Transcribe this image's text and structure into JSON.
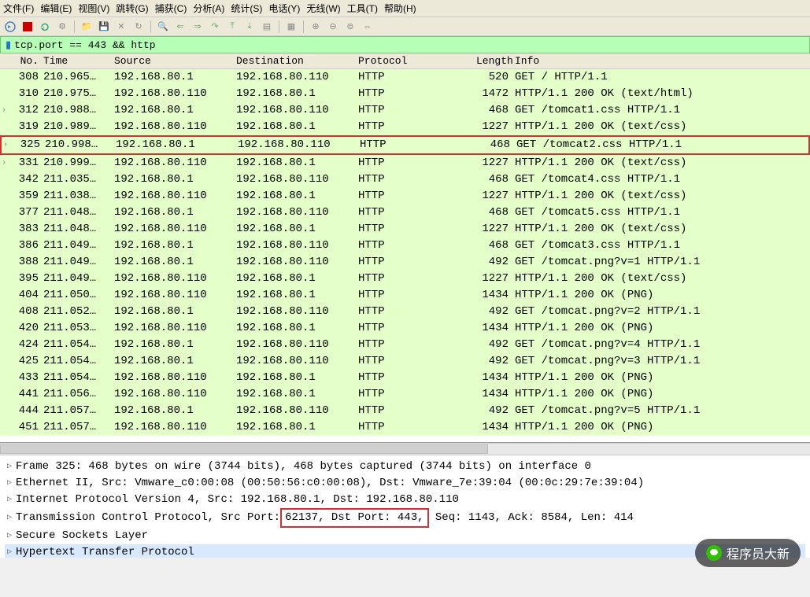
{
  "menubar": {
    "file": "文件(F)",
    "edit": "编辑(E)",
    "view": "视图(V)",
    "goto": "跳转(G)",
    "capture": "捕获(C)",
    "analyze": "分析(A)",
    "stats": "统计(S)",
    "telephony": "电话(Y)",
    "wireless": "无线(W)",
    "tools": "工具(T)",
    "help": "帮助(H)"
  },
  "filter": {
    "value": "tcp.port == 443 && http"
  },
  "columns": {
    "no": "No.",
    "time": "Time",
    "source": "Source",
    "destination": "Destination",
    "protocol": "Protocol",
    "length": "Length",
    "info": "Info"
  },
  "packets": [
    {
      "no": "308",
      "time": "210.965…",
      "src": "192.168.80.1",
      "dst": "192.168.80.110",
      "proto": "HTTP",
      "len": "520",
      "info": "GET  /  HTTP/1.1",
      "marker": ""
    },
    {
      "no": "310",
      "time": "210.975…",
      "src": "192.168.80.110",
      "dst": "192.168.80.1",
      "proto": "HTTP",
      "len": "1472",
      "info": "HTTP/1.1 200 OK  (text/html)",
      "marker": ""
    },
    {
      "no": "312",
      "time": "210.988…",
      "src": "192.168.80.1",
      "dst": "192.168.80.110",
      "proto": "HTTP",
      "len": "468",
      "info": "GET  /tomcat1.css HTTP/1.1",
      "marker": "›"
    },
    {
      "no": "319",
      "time": "210.989…",
      "src": "192.168.80.110",
      "dst": "192.168.80.1",
      "proto": "HTTP",
      "len": "1227",
      "info": "HTTP/1.1 200 OK   (text/css)",
      "marker": ""
    },
    {
      "no": "325",
      "time": "210.998…",
      "src": "192.168.80.1",
      "dst": "192.168.80.110",
      "proto": "HTTP",
      "len": "468",
      "info": "GET  /tomcat2.css HTTP/1.1",
      "marker": "›",
      "highlight": true
    },
    {
      "no": "331",
      "time": "210.999…",
      "src": "192.168.80.110",
      "dst": "192.168.80.1",
      "proto": "HTTP",
      "len": "1227",
      "info": "HTTP/1.1 200 OK   (text/css)",
      "marker": "›"
    },
    {
      "no": "342",
      "time": "211.035…",
      "src": "192.168.80.1",
      "dst": "192.168.80.110",
      "proto": "HTTP",
      "len": "468",
      "info": "GET  /tomcat4.css HTTP/1.1",
      "marker": ""
    },
    {
      "no": "359",
      "time": "211.038…",
      "src": "192.168.80.110",
      "dst": "192.168.80.1",
      "proto": "HTTP",
      "len": "1227",
      "info": "HTTP/1.1 200 OK   (text/css)",
      "marker": ""
    },
    {
      "no": "377",
      "time": "211.048…",
      "src": "192.168.80.1",
      "dst": "192.168.80.110",
      "proto": "HTTP",
      "len": "468",
      "info": "GET  /tomcat5.css HTTP/1.1",
      "marker": ""
    },
    {
      "no": "383",
      "time": "211.048…",
      "src": "192.168.80.110",
      "dst": "192.168.80.1",
      "proto": "HTTP",
      "len": "1227",
      "info": "HTTP/1.1 200 OK   (text/css)",
      "marker": ""
    },
    {
      "no": "386",
      "time": "211.049…",
      "src": "192.168.80.1",
      "dst": "192.168.80.110",
      "proto": "HTTP",
      "len": "468",
      "info": "GET  /tomcat3.css HTTP/1.1",
      "marker": ""
    },
    {
      "no": "388",
      "time": "211.049…",
      "src": "192.168.80.1",
      "dst": "192.168.80.110",
      "proto": "HTTP",
      "len": "492",
      "info": "GET  /tomcat.png?v=1 HTTP/1.1",
      "marker": ""
    },
    {
      "no": "395",
      "time": "211.049…",
      "src": "192.168.80.110",
      "dst": "192.168.80.1",
      "proto": "HTTP",
      "len": "1227",
      "info": "HTTP/1.1 200 OK   (text/css)",
      "marker": ""
    },
    {
      "no": "404",
      "time": "211.050…",
      "src": "192.168.80.110",
      "dst": "192.168.80.1",
      "proto": "HTTP",
      "len": "1434",
      "info": "HTTP/1.1 200 OK   (PNG)",
      "marker": ""
    },
    {
      "no": "408",
      "time": "211.052…",
      "src": "192.168.80.1",
      "dst": "192.168.80.110",
      "proto": "HTTP",
      "len": "492",
      "info": "GET  /tomcat.png?v=2 HTTP/1.1",
      "marker": ""
    },
    {
      "no": "420",
      "time": "211.053…",
      "src": "192.168.80.110",
      "dst": "192.168.80.1",
      "proto": "HTTP",
      "len": "1434",
      "info": "HTTP/1.1 200 OK   (PNG)",
      "marker": ""
    },
    {
      "no": "424",
      "time": "211.054…",
      "src": "192.168.80.1",
      "dst": "192.168.80.110",
      "proto": "HTTP",
      "len": "492",
      "info": "GET  /tomcat.png?v=4 HTTP/1.1",
      "marker": ""
    },
    {
      "no": "425",
      "time": "211.054…",
      "src": "192.168.80.1",
      "dst": "192.168.80.110",
      "proto": "HTTP",
      "len": "492",
      "info": "GET  /tomcat.png?v=3 HTTP/1.1",
      "marker": ""
    },
    {
      "no": "433",
      "time": "211.054…",
      "src": "192.168.80.110",
      "dst": "192.168.80.1",
      "proto": "HTTP",
      "len": "1434",
      "info": "HTTP/1.1 200 OK   (PNG)",
      "marker": ""
    },
    {
      "no": "441",
      "time": "211.056…",
      "src": "192.168.80.110",
      "dst": "192.168.80.1",
      "proto": "HTTP",
      "len": "1434",
      "info": "HTTP/1.1 200 OK   (PNG)",
      "marker": ""
    },
    {
      "no": "444",
      "time": "211.057…",
      "src": "192.168.80.1",
      "dst": "192.168.80.110",
      "proto": "HTTP",
      "len": "492",
      "info": "GET  /tomcat.png?v=5 HTTP/1.1",
      "marker": ""
    },
    {
      "no": "451",
      "time": "211.057…",
      "src": "192.168.80.110",
      "dst": "192.168.80.1",
      "proto": "HTTP",
      "len": "1434",
      "info": "HTTP/1.1 200 OK   (PNG)",
      "marker": ""
    }
  ],
  "details": {
    "frame": "Frame 325: 468 bytes on wire (3744 bits), 468 bytes captured (3744 bits) on interface 0",
    "eth": "Ethernet II, Src: Vmware_c0:00:08 (00:50:56:c0:00:08), Dst: Vmware_7e:39:04 (00:0c:29:7e:39:04)",
    "ip": "Internet Protocol Version 4, Src: 192.168.80.1, Dst: 192.168.80.110",
    "tcp_pre": "Transmission Control Protocol, Src Port:",
    "tcp_box": " 62137, Dst Port: 443,",
    "tcp_post": " Seq: 1143, Ack: 8584, Len: 414",
    "ssl": "Secure Sockets Layer",
    "http": "Hypertext Transfer Protocol"
  },
  "watermark": {
    "text": "程序员大新"
  }
}
